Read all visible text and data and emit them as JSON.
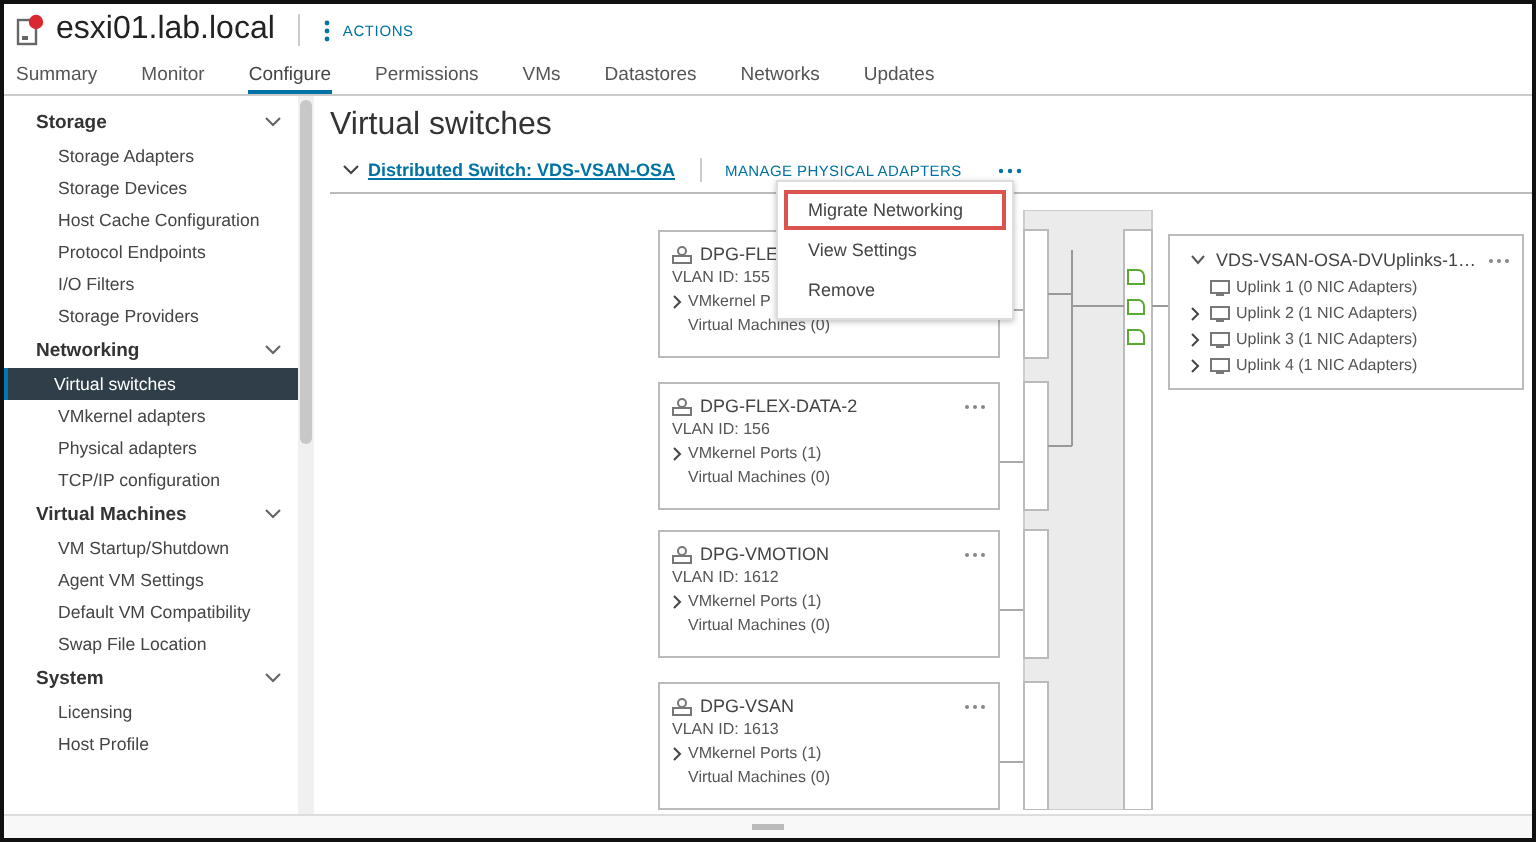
{
  "header": {
    "title": "esxi01.lab.local",
    "actions": "ACTIONS"
  },
  "tabs": [
    {
      "label": "Summary",
      "selected": false
    },
    {
      "label": "Monitor",
      "selected": false
    },
    {
      "label": "Configure",
      "selected": true
    },
    {
      "label": "Permissions",
      "selected": false
    },
    {
      "label": "VMs",
      "selected": false
    },
    {
      "label": "Datastores",
      "selected": false
    },
    {
      "label": "Networks",
      "selected": false
    },
    {
      "label": "Updates",
      "selected": false
    }
  ],
  "sidebar": {
    "groups": [
      {
        "label": "Storage",
        "expanded": true,
        "items": [
          {
            "label": "Storage Adapters",
            "selected": false
          },
          {
            "label": "Storage Devices",
            "selected": false
          },
          {
            "label": "Host Cache Configuration",
            "selected": false
          },
          {
            "label": "Protocol Endpoints",
            "selected": false
          },
          {
            "label": "I/O Filters",
            "selected": false
          },
          {
            "label": "Storage Providers",
            "selected": false
          }
        ]
      },
      {
        "label": "Networking",
        "expanded": true,
        "items": [
          {
            "label": "Virtual switches",
            "selected": true
          },
          {
            "label": "VMkernel adapters",
            "selected": false
          },
          {
            "label": "Physical adapters",
            "selected": false
          },
          {
            "label": "TCP/IP configuration",
            "selected": false
          }
        ]
      },
      {
        "label": "Virtual Machines",
        "expanded": true,
        "items": [
          {
            "label": "VM Startup/Shutdown",
            "selected": false
          },
          {
            "label": "Agent VM Settings",
            "selected": false
          },
          {
            "label": "Default VM Compatibility",
            "selected": false
          },
          {
            "label": "Swap File Location",
            "selected": false
          }
        ]
      },
      {
        "label": "System",
        "expanded": true,
        "items": [
          {
            "label": "Licensing",
            "selected": false
          },
          {
            "label": "Host Profile",
            "selected": false
          }
        ]
      }
    ]
  },
  "main": {
    "title": "Virtual switches",
    "switch": {
      "label": "Distributed Switch: VDS-VSAN-OSA",
      "expanded": true,
      "manage": "MANAGE PHYSICAL ADAPTERS"
    },
    "port_groups": [
      {
        "name": "DPG-FLE",
        "vlan": "VLAN ID: 155",
        "vmkernel": "VMkernel P",
        "vms": "Virtual Machines (0)"
      },
      {
        "name": "DPG-FLEX-DATA-2",
        "vlan": "VLAN ID: 156",
        "vmkernel": "VMkernel Ports (1)",
        "vms": "Virtual Machines (0)"
      },
      {
        "name": "DPG-VMOTION",
        "vlan": "VLAN ID: 1612",
        "vmkernel": "VMkernel Ports (1)",
        "vms": "Virtual Machines (0)"
      },
      {
        "name": "DPG-VSAN",
        "vlan": "VLAN ID: 1613",
        "vmkernel": "VMkernel Ports (1)",
        "vms": "Virtual Machines (0)"
      }
    ],
    "uplinks": {
      "name": "VDS-VSAN-OSA-DVUplinks-1…",
      "expanded": true,
      "items": [
        {
          "label": "Uplink 1 (0 NIC Adapters)",
          "expandable": false
        },
        {
          "label": "Uplink 2 (1 NIC Adapters)",
          "expandable": true
        },
        {
          "label": "Uplink 3 (1 NIC Adapters)",
          "expandable": true
        },
        {
          "label": "Uplink 4 (1 NIC Adapters)",
          "expandable": true
        }
      ]
    },
    "menu": [
      {
        "label": "Migrate Networking",
        "highlighted": true
      },
      {
        "label": "View Settings",
        "highlighted": false
      },
      {
        "label": "Remove",
        "highlighted": false
      }
    ]
  }
}
